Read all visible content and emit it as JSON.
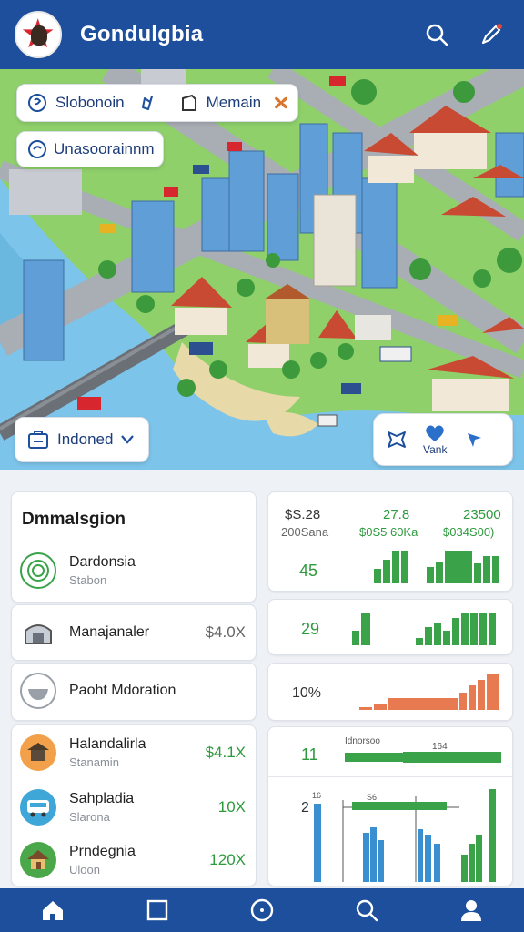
{
  "header": {
    "title": "Gondulgbia",
    "icons": [
      "flag-logo",
      "search-icon",
      "edit-pen-icon"
    ]
  },
  "map": {
    "chip_1a_label": "Slobonoin",
    "chip_1b_label": "Memain",
    "chip_2_label": "Unasoorainnm",
    "region_label": "Indoned",
    "action_label": "Vank",
    "colors": {
      "water": "#7dc4ea",
      "land": "#8fd06b",
      "road": "#a9aeb5",
      "roof": "#c84a32",
      "tower": "#5f9ed6"
    }
  },
  "panel": {
    "title": "Dmmalsgion",
    "items": [
      {
        "name": "Dardonsia",
        "sub": "Stabon",
        "value": "",
        "icon": "target-icon"
      },
      {
        "name": "Manajanaler",
        "sub": "",
        "value": "$4.0X",
        "icon": "gate-icon"
      },
      {
        "name": "Paoht Mdoration",
        "sub": "",
        "value": "",
        "icon": "bowl-icon"
      },
      {
        "name": "Halandalirla",
        "sub": "Stanamin",
        "value": "$4.1X",
        "icon": "pavilion-icon"
      },
      {
        "name": "Sahpladia",
        "sub": "Slarona",
        "value": "10X",
        "icon": "bus-icon"
      },
      {
        "name": "Prndegnia",
        "sub": "Uloon",
        "value": "120X",
        "icon": "house-icon"
      }
    ]
  },
  "stats": {
    "card1": {
      "col_a_top": "$S.28",
      "col_a_sub": "200Sana",
      "col_b_top": "27.8",
      "col_b_sub": "$0S5 60Ka",
      "col_c_top": "23500",
      "col_c_sub": "$034S00)",
      "metric": "45"
    },
    "card2": {
      "metric": "29"
    },
    "card3": {
      "metric": "10%"
    },
    "card4": {
      "metric_top": "11",
      "label_top": "Idnorsoo",
      "label_top_right": "164",
      "metric_bottom": "2",
      "label_small_a": "16",
      "label_small_b": "S6"
    }
  },
  "nav": {
    "items": [
      "home-icon",
      "square-icon",
      "circle-icon",
      "search-icon",
      "profile-icon"
    ]
  }
}
